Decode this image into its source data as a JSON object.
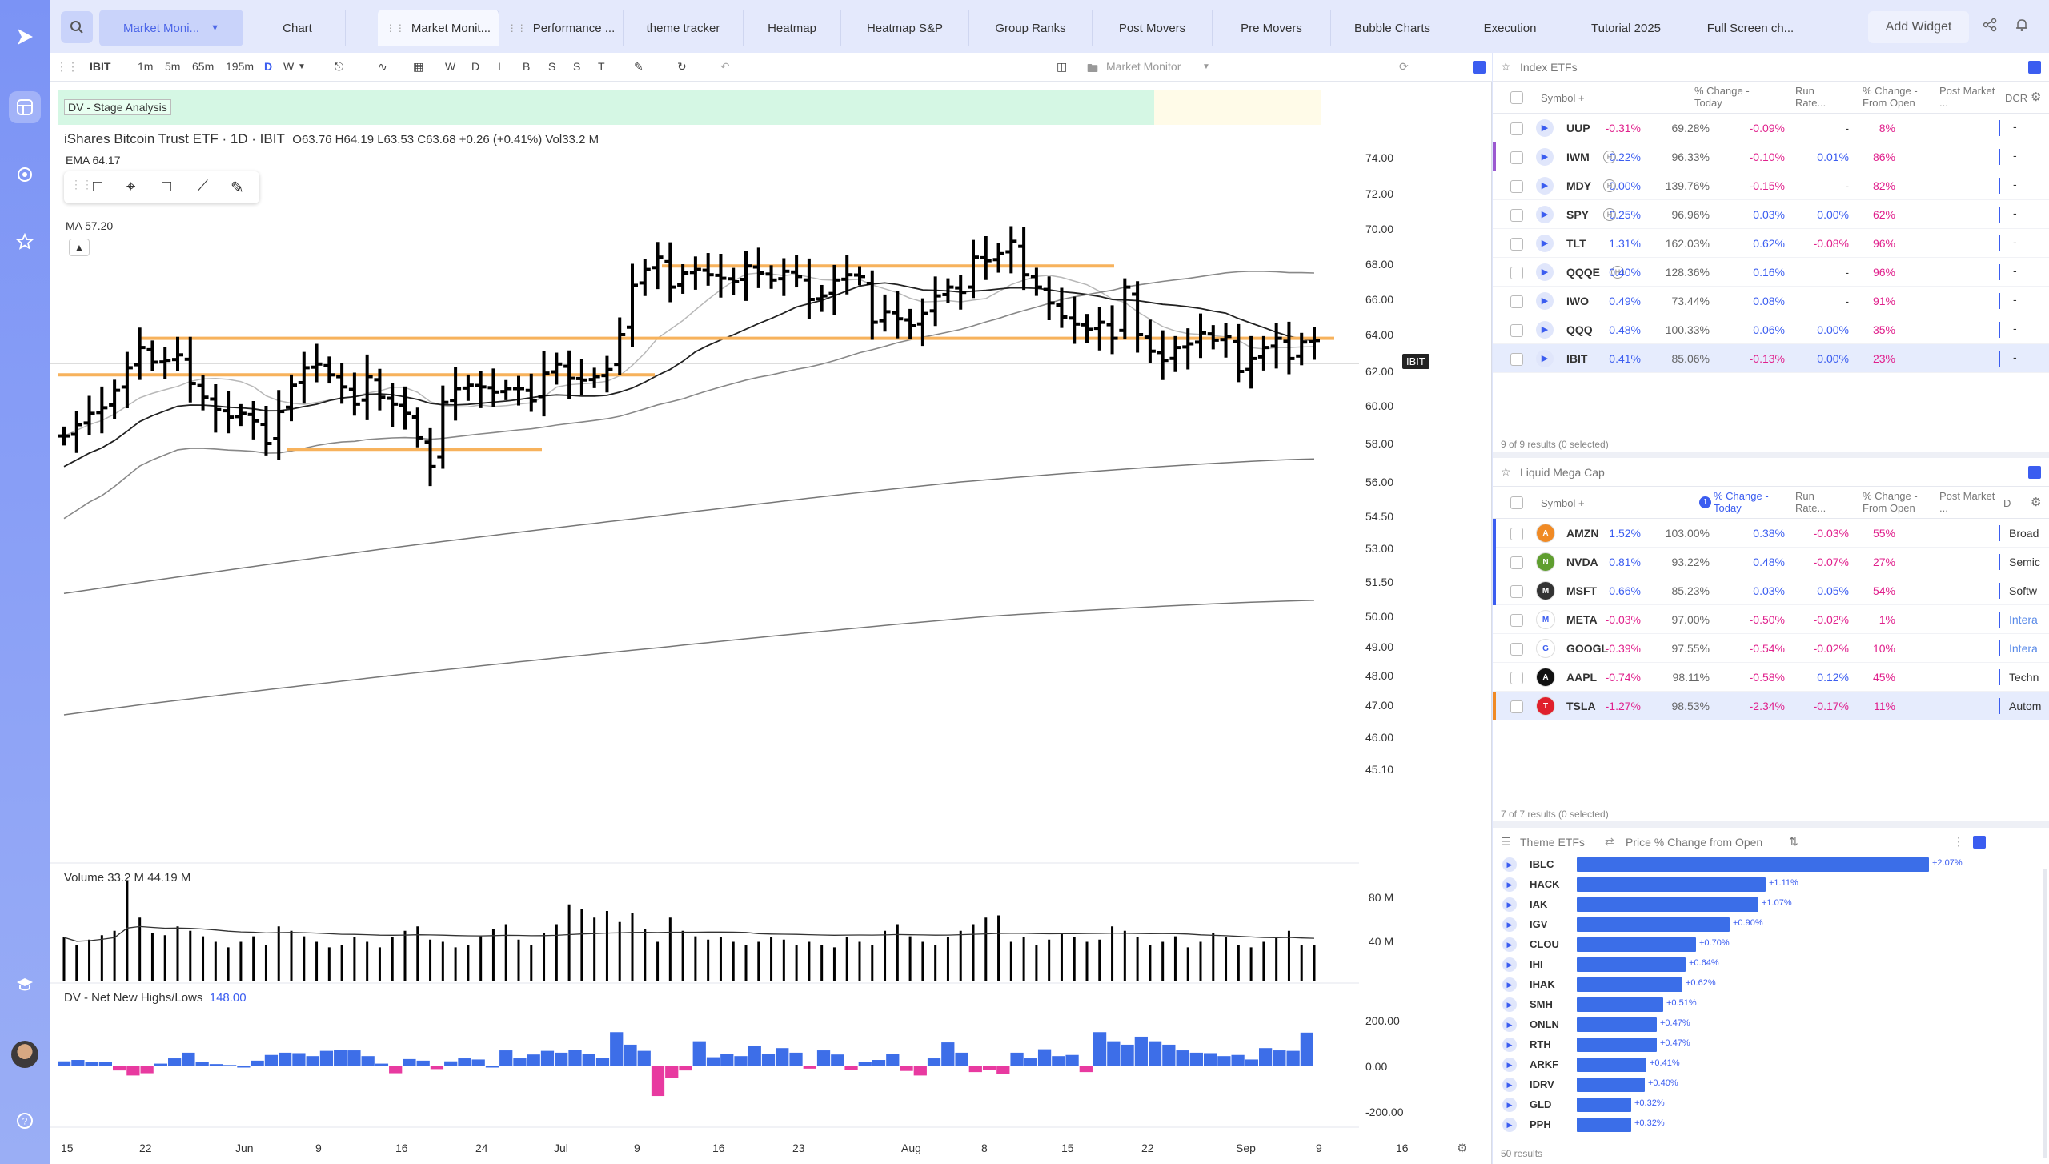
{
  "tabs": {
    "search_dropdown": "Market Moni...",
    "items": [
      "Chart",
      "Market Monit...",
      "Performance ...",
      "theme tracker",
      "Heatmap",
      "Heatmap S&P",
      "Group Ranks",
      "Post Movers",
      "Pre Movers",
      "Bubble Charts",
      "Execution",
      "Tutorial 2025",
      "Full Screen ch..."
    ],
    "add_widget": "Add Widget"
  },
  "toolbar": {
    "symbol": "IBIT",
    "intervals": [
      "1m",
      "5m",
      "65m",
      "195m",
      "D",
      "W"
    ],
    "active_interval": "D",
    "period_letters": [
      "W",
      "D",
      "I",
      "B",
      "S",
      "S",
      "T"
    ],
    "layout_name": "Market Monitor"
  },
  "chart": {
    "stage_label": "DV - Stage Analysis",
    "title": "iShares Bitcoin Trust ETF · 1D · IBIT",
    "ohlc": "O63.76  H64.19  L63.53  C63.68  +0.26 (+0.41%)  Vol33.2 M",
    "ema": "EMA  64.17",
    "ma": "MA  57.20",
    "last_price_tag": "IBIT",
    "price_ticks": [
      "74.00",
      "72.00",
      "70.00",
      "68.00",
      "66.00",
      "64.00",
      "62.00",
      "60.00",
      "58.00",
      "56.00",
      "54.50",
      "53.00",
      "51.50",
      "50.00",
      "49.00",
      "48.00",
      "47.00",
      "46.00",
      "45.10"
    ],
    "volume_label": "Volume  33.2 M  44.19 M",
    "volume_ticks": [
      "80 M",
      "40 M"
    ],
    "nnh_label": "DV - Net New Highs/Lows",
    "nnh_value": "148.00",
    "nnh_ticks": [
      "200.00",
      "0.00",
      "-200.00"
    ],
    "time_ticks": [
      "15",
      "22",
      "Jun",
      "9",
      "16",
      "24",
      "Jul",
      "9",
      "16",
      "23",
      "Aug",
      "8",
      "15",
      "22",
      "Sep",
      "9",
      "16"
    ]
  },
  "chart_data": {
    "type": "bar",
    "title": "iShares Bitcoin Trust ETF · 1D · IBIT",
    "price_range": [
      45.1,
      74
    ],
    "bars_close": [
      58.4,
      59.0,
      59.6,
      59.9,
      60.9,
      62.2,
      63.3,
      62.5,
      62.6,
      62.9,
      61.3,
      60.5,
      59.8,
      59.4,
      59.6,
      59.2,
      58.0,
      59.7,
      61.2,
      62.2,
      62.4,
      61.8,
      61.1,
      60.1,
      61.7,
      60.5,
      60.1,
      59.6,
      58.3,
      56.8,
      60.2,
      61.0,
      61.2,
      61.1,
      60.8,
      61.0,
      61.0,
      60.3,
      61.9,
      62.4,
      61.6,
      61.5,
      61.7,
      62.1,
      64.0,
      66.8,
      67.7,
      68.4,
      66.7,
      67.5,
      67.7,
      67.4,
      67.2,
      67.0,
      67.9,
      67.5,
      67.1,
      67.6,
      67.3,
      66.0,
      66.2,
      67.1,
      67.4,
      67.3,
      64.7,
      65.3,
      64.9,
      64.5,
      65.2,
      66.2,
      66.7,
      66.4,
      68.4,
      68.2,
      68.6,
      69.3,
      67.4,
      66.7,
      65.8,
      65.0,
      64.6,
      64.3,
      64.7,
      63.8,
      66.7,
      64.0,
      63.1,
      62.6,
      63.3,
      63.5,
      64.1,
      63.7,
      63.9,
      62.0,
      62.7,
      63.3,
      63.8,
      62.7,
      63.6,
      63.68
    ],
    "volume": [
      40,
      33,
      38,
      42,
      46,
      92,
      58,
      44,
      42,
      50,
      46,
      41,
      36,
      31,
      36,
      41,
      33,
      50,
      46,
      41,
      36,
      31,
      33,
      40,
      36,
      31,
      40,
      46,
      50,
      38,
      36,
      31,
      33,
      41,
      48,
      52,
      38,
      33,
      44,
      52,
      70,
      66,
      58,
      64,
      54,
      62,
      48,
      36,
      58,
      46,
      41,
      38,
      40,
      36,
      33,
      36,
      40,
      38,
      33,
      36,
      33,
      31,
      40,
      36,
      33,
      46,
      52,
      41,
      36,
      33,
      40,
      46,
      52,
      58,
      60,
      36,
      40,
      33,
      38,
      43,
      40,
      36,
      38,
      50,
      46,
      40,
      33,
      36,
      41,
      31,
      36,
      44,
      40,
      33,
      31,
      36,
      40,
      46,
      33,
      33.2
    ],
    "net_new_highs_lows": [
      22,
      28,
      18,
      20,
      -18,
      -40,
      -30,
      12,
      35,
      60,
      18,
      10,
      6,
      0,
      25,
      50,
      60,
      58,
      45,
      68,
      72,
      70,
      45,
      12,
      -30,
      32,
      25,
      -12,
      22,
      35,
      30,
      0,
      70,
      35,
      52,
      68,
      60,
      72,
      55,
      38,
      150,
      95,
      68,
      -130,
      -50,
      -18,
      110,
      40,
      55,
      45,
      90,
      55,
      80,
      60,
      -10,
      70,
      52,
      -15,
      18,
      28,
      55,
      -20,
      -40,
      35,
      105,
      60,
      -25,
      -15,
      -35,
      60,
      35,
      75,
      45,
      50,
      -25,
      150,
      110,
      95,
      130,
      110,
      95,
      70,
      60,
      58,
      45,
      50,
      30,
      80,
      70,
      68,
      148
    ]
  },
  "index_etfs": {
    "title": "Index ETFs",
    "headers": [
      "Symbol",
      "% Change - Today",
      "Run Rate...",
      "% Change - From Open",
      "Post Market ...",
      "DCR"
    ],
    "rows": [
      {
        "sym": "UUP",
        "chg": "-0.31%",
        "run": "69.28%",
        "open": "-0.09%",
        "post": "-",
        "dcr": "8%",
        "marker": ""
      },
      {
        "sym": "IWM",
        "chg": "0.22%",
        "run": "96.33%",
        "open": "-0.10%",
        "post": "0.01%",
        "dcr": "86%",
        "marker": "#9b59d0"
      },
      {
        "sym": "MDY",
        "chg": "0.00%",
        "run": "139.76%",
        "open": "-0.15%",
        "post": "-",
        "dcr": "82%",
        "marker": ""
      },
      {
        "sym": "SPY",
        "chg": "0.25%",
        "run": "96.96%",
        "open": "0.03%",
        "post": "0.00%",
        "dcr": "62%",
        "marker": ""
      },
      {
        "sym": "TLT",
        "chg": "1.31%",
        "run": "162.03%",
        "open": "0.62%",
        "post": "-0.08%",
        "dcr": "96%",
        "marker": ""
      },
      {
        "sym": "QQQE",
        "chg": "0.40%",
        "run": "128.36%",
        "open": "0.16%",
        "post": "-",
        "dcr": "96%",
        "marker": ""
      },
      {
        "sym": "IWO",
        "chg": "0.49%",
        "run": "73.44%",
        "open": "0.08%",
        "post": "-",
        "dcr": "91%",
        "marker": ""
      },
      {
        "sym": "QQQ",
        "chg": "0.48%",
        "run": "100.33%",
        "open": "0.06%",
        "post": "0.00%",
        "dcr": "35%",
        "marker": ""
      },
      {
        "sym": "IBIT",
        "chg": "0.41%",
        "run": "85.06%",
        "open": "-0.13%",
        "post": "0.00%",
        "dcr": "23%",
        "marker": ""
      }
    ],
    "results": "9 of 9 results (0 selected)"
  },
  "mega_cap": {
    "title": "Liquid Mega Cap",
    "headers": [
      "Symbol",
      "% Change - Today",
      "Run Rate...",
      "% Change - From Open",
      "Post Market ...",
      "D"
    ],
    "rows": [
      {
        "sym": "AMZN",
        "chg": "1.52%",
        "run": "103.00%",
        "open": "0.38%",
        "post": "-0.03%",
        "dcr": "55%",
        "sector": "Broad",
        "logo": "#f08a24",
        "marker": "#3b5df0"
      },
      {
        "sym": "NVDA",
        "chg": "0.81%",
        "run": "93.22%",
        "open": "0.48%",
        "post": "-0.07%",
        "dcr": "27%",
        "sector": "Semic",
        "logo": "#5f9e2f",
        "marker": "#3b5df0"
      },
      {
        "sym": "MSFT",
        "chg": "0.66%",
        "run": "85.23%",
        "open": "0.03%",
        "post": "0.05%",
        "dcr": "54%",
        "sector": "Softw",
        "logo": "#333333",
        "marker": "#3b5df0"
      },
      {
        "sym": "META",
        "chg": "-0.03%",
        "run": "97.00%",
        "open": "-0.50%",
        "post": "-0.02%",
        "dcr": "1%",
        "sector": "Intera",
        "logo": "#ffffff",
        "marker": ""
      },
      {
        "sym": "GOOGL",
        "chg": "-0.39%",
        "run": "97.55%",
        "open": "-0.54%",
        "post": "-0.02%",
        "dcr": "10%",
        "sector": "Intera",
        "logo": "#ffffff",
        "marker": ""
      },
      {
        "sym": "AAPL",
        "chg": "-0.74%",
        "run": "98.11%",
        "open": "-0.58%",
        "post": "0.12%",
        "dcr": "45%",
        "sector": "Techn",
        "logo": "#111111",
        "marker": ""
      },
      {
        "sym": "TSLA",
        "chg": "-1.27%",
        "run": "98.53%",
        "open": "-2.34%",
        "post": "-0.17%",
        "dcr": "11%",
        "sector": "Autom",
        "logo": "#e0202c",
        "marker": "#f08a24"
      }
    ],
    "results": "7 of 7 results (0 selected)"
  },
  "theme_etfs": {
    "title": "Theme ETFs",
    "metric": "Price % Change from Open",
    "rows": [
      {
        "sym": "IBLC",
        "val": 2.07,
        "label": "+2.07%"
      },
      {
        "sym": "HACK",
        "val": 1.11,
        "label": "+1.11%"
      },
      {
        "sym": "IAK",
        "val": 1.07,
        "label": "+1.07%"
      },
      {
        "sym": "IGV",
        "val": 0.9,
        "label": "+0.90%"
      },
      {
        "sym": "CLOU",
        "val": 0.7,
        "label": "+0.70%"
      },
      {
        "sym": "IHI",
        "val": 0.64,
        "label": "+0.64%"
      },
      {
        "sym": "IHAK",
        "val": 0.62,
        "label": "+0.62%"
      },
      {
        "sym": "SMH",
        "val": 0.51,
        "label": "+0.51%"
      },
      {
        "sym": "ONLN",
        "val": 0.47,
        "label": "+0.47%"
      },
      {
        "sym": "RTH",
        "val": 0.47,
        "label": "+0.47%"
      },
      {
        "sym": "ARKF",
        "val": 0.41,
        "label": "+0.41%"
      },
      {
        "sym": "IDRV",
        "val": 0.4,
        "label": "+0.40%"
      },
      {
        "sym": "GLD",
        "val": 0.32,
        "label": "+0.32%"
      },
      {
        "sym": "PPH",
        "val": 0.32,
        "label": "+0.32%"
      }
    ],
    "results": "50 results"
  }
}
